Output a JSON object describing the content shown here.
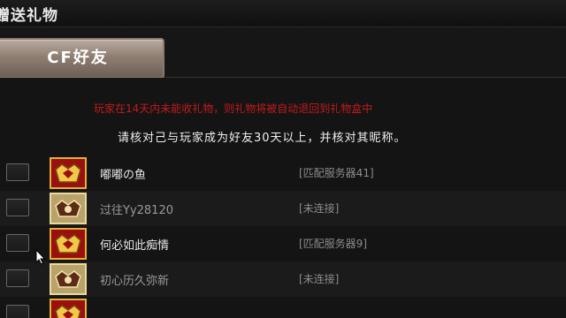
{
  "window": {
    "title": "赠送礼物"
  },
  "tabs": [
    {
      "label": "CF好友",
      "active": true
    }
  ],
  "notice": {
    "warning": "玩家在14天内未能收礼物，则礼物将被自动退回到礼物盒中",
    "instruction": "请核对己与玩家成为好友30天以上，并核对其昵称。"
  },
  "friends": [
    {
      "name": "嘟嘟の鱼",
      "status": "[匹配服务器41]",
      "rank_icon": "rank-badge-icon",
      "online": true
    },
    {
      "name": "过往Yy28120",
      "status": "[未连接]",
      "rank_icon": "rank-badge-icon",
      "online": false
    },
    {
      "name": "何必如此痴情",
      "status": "[匹配服务器9]",
      "rank_icon": "rank-badge-icon",
      "online": true
    },
    {
      "name": "初心历久弥新",
      "status": "[未连接]",
      "rank_icon": "rank-badge-icon",
      "online": false
    },
    {
      "name": "",
      "status": "",
      "rank_icon": "rank-badge-icon",
      "online": true
    }
  ],
  "colors": {
    "warning": "#c21b1b",
    "tab_active": "#8f7f73",
    "rank_badge": "#9a1010"
  }
}
